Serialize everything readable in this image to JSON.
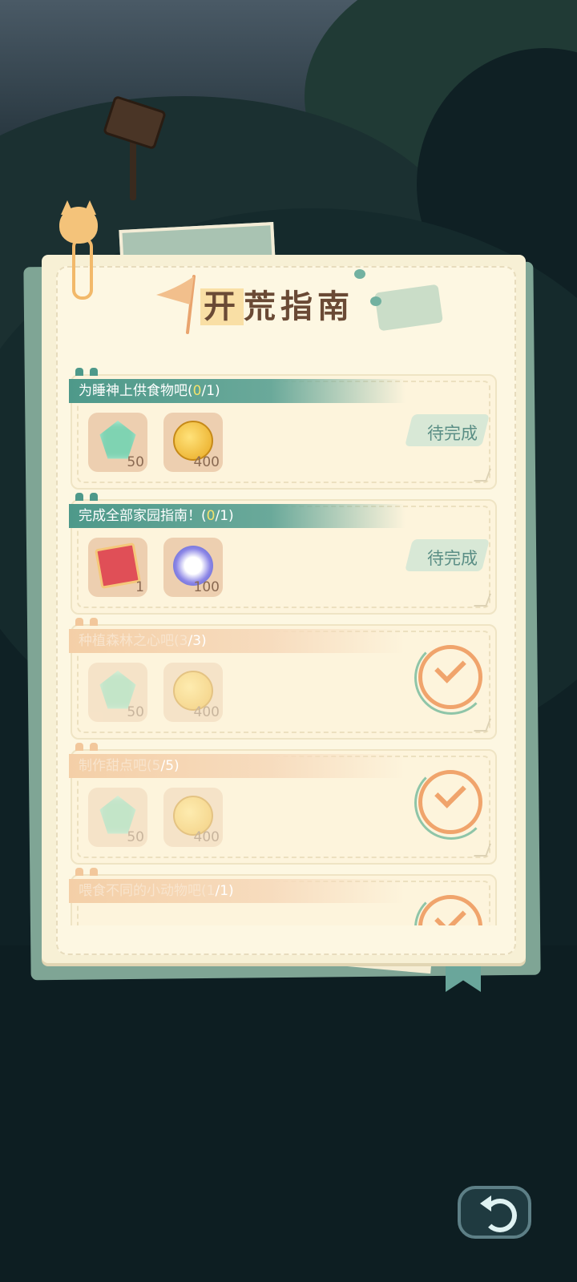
{
  "title": {
    "prefix": "开",
    "rest": "荒指南"
  },
  "tasks": [
    {
      "name": "为睡神上供食物吧(",
      "progress_current": "0",
      "progress_total": "/1)",
      "status": "待完成",
      "done": false,
      "rewards": [
        {
          "icon": "green-gem-icon",
          "count": "50"
        },
        {
          "icon": "gold-coin-icon",
          "count": "400"
        }
      ]
    },
    {
      "name": "完成全部家园指南！(",
      "progress_current": "0",
      "progress_total": "/1)",
      "status": "待完成",
      "done": false,
      "rewards": [
        {
          "icon": "recipe-book-icon",
          "count": "1"
        },
        {
          "icon": "moon-orb-icon",
          "count": "100"
        }
      ]
    },
    {
      "name": "种植森林之心吧(",
      "progress_current": "3",
      "progress_total": "/3)",
      "status": "",
      "done": true,
      "rewards": [
        {
          "icon": "green-gem-icon",
          "count": "50"
        },
        {
          "icon": "gold-coin-icon",
          "count": "400"
        }
      ]
    },
    {
      "name": "制作甜点吧(",
      "progress_current": "5",
      "progress_total": "/5)",
      "status": "",
      "done": true,
      "rewards": [
        {
          "icon": "green-gem-icon",
          "count": "50"
        },
        {
          "icon": "gold-coin-icon",
          "count": "400"
        }
      ]
    },
    {
      "name": "喂食不同的小动物吧(",
      "progress_current": "1",
      "progress_total": "/1)",
      "status": "",
      "done": true,
      "rewards": []
    }
  ],
  "back_button": {
    "icon": "undo-arrow-icon"
  }
}
